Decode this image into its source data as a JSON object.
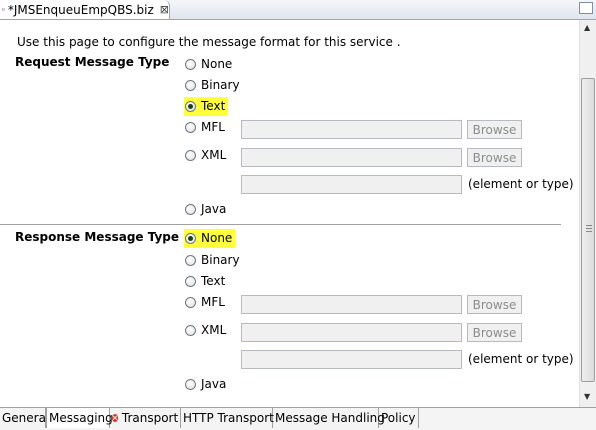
{
  "editor": {
    "title": "*JMSEnqueuEmpQBS.biz",
    "close_glyph": "⊠",
    "icon": "proxy-service-icon"
  },
  "intro_text": "Use this page to configure the message format for this service .",
  "request": {
    "label": "Request Message Type",
    "options": [
      "None",
      "Binary",
      "Text",
      "MFL",
      "XML",
      "Java"
    ],
    "selected": "Text",
    "browse_label": "Browse",
    "element_hint": "(element or type)"
  },
  "response": {
    "label": "Response Message Type",
    "options": [
      "None",
      "Binary",
      "Text",
      "MFL",
      "XML",
      "Java"
    ],
    "selected": "None",
    "browse_label": "Browse",
    "element_hint": "(element or type)"
  },
  "bottom_tabs": [
    "General",
    "Messaging",
    "Transport",
    "HTTP Transport",
    "Message Handling",
    "Policy"
  ],
  "active_tab": "Messaging",
  "highlight_color": "#ffff3a"
}
